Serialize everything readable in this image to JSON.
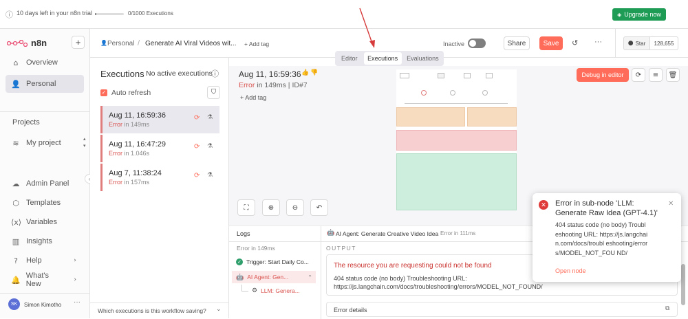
{
  "topbar": {
    "trial_text": "10 days left in your n8n trial",
    "executions_count": "0/1000 Executions",
    "executions_progress": 0,
    "upgrade_label": "Upgrade now"
  },
  "brand": {
    "name": "n8n"
  },
  "sidebar": {
    "items": [
      {
        "label": "Overview",
        "icon": "home-icon"
      },
      {
        "label": "Personal",
        "icon": "user-icon"
      }
    ],
    "projects_heading": "Projects",
    "project_item": "My project",
    "bottom_items": [
      {
        "label": "Admin Panel",
        "icon": "cloud-icon"
      },
      {
        "label": "Templates",
        "icon": "box-icon"
      },
      {
        "label": "Variables",
        "icon": "variables-icon"
      },
      {
        "label": "Insights",
        "icon": "chart-icon"
      },
      {
        "label": "Help",
        "icon": "help-icon"
      },
      {
        "label": "What's New",
        "icon": "bell-icon"
      }
    ],
    "user_initials": "SK",
    "user_name": "Simon Kimotho"
  },
  "header": {
    "breadcrumb_project": "Personal",
    "workflow_name": "Generate AI Viral Videos wit...",
    "add_tag": "+ Add tag",
    "status": "Inactive",
    "share": "Share",
    "save": "Save",
    "github_star": "Star",
    "github_count": "128,655",
    "tabs": [
      "Editor",
      "Executions",
      "Evaluations"
    ],
    "active_tab": "Executions"
  },
  "executions": {
    "title": "Executions",
    "subtitle": "No active executions",
    "auto_refresh": "Auto refresh",
    "list": [
      {
        "date": "Aug 11, 16:59:36",
        "status": "Error",
        "duration": "in 149ms"
      },
      {
        "date": "Aug 11, 16:47:29",
        "status": "Error",
        "duration": "in 1.046s"
      },
      {
        "date": "Aug 7, 11:38:24",
        "status": "Error",
        "duration": "in 157ms"
      }
    ],
    "footer_question": "Which executions is this workflow saving?"
  },
  "detail": {
    "date": "Aug 11, 16:59:36",
    "status": "Error",
    "duration": "in 149ms",
    "id": "| ID#7",
    "add_tag": "+ Add tag",
    "debug_button": "Debug in editor"
  },
  "logs": {
    "title": "Logs",
    "summary": "Error in 149ms",
    "entries": [
      {
        "label": "Trigger: Start Daily Co...",
        "icon": "check-circle-icon",
        "color": "#2e9e6b"
      },
      {
        "label": "AI Agent: Gen...",
        "icon": "robot-icon",
        "color": "#d9534f"
      },
      {
        "label": "LLM: Genera...",
        "icon": "openai-icon",
        "color": "#d9534f"
      }
    ],
    "node_title": "AI Agent: Generate Creative Video Idea",
    "node_status": "Error in 111ms",
    "output_label": "OUTPUT",
    "error_title": "The resource you are requesting could not be found",
    "error_body": "404 status code (no body) Troubleshooting URL: https://js.langchain.com/docs/troubleshooting/errors/MODEL_NOT_FOUND/",
    "error_details": "Error details"
  },
  "toast": {
    "title": "Error in sub-node 'LLM: Generate Raw Idea (GPT-4.1)'",
    "body": "404 status code (no body) Troubleshooting URL: https://js.langchain.com/docs/troubl eshooting/errors/MODEL_NOT_FOU ND/",
    "link": "Open node"
  },
  "colors": {
    "accent": "#ff6d5a",
    "upgrade": "#1e9c55",
    "error": "#d9534f",
    "success": "#2e9e6b"
  }
}
